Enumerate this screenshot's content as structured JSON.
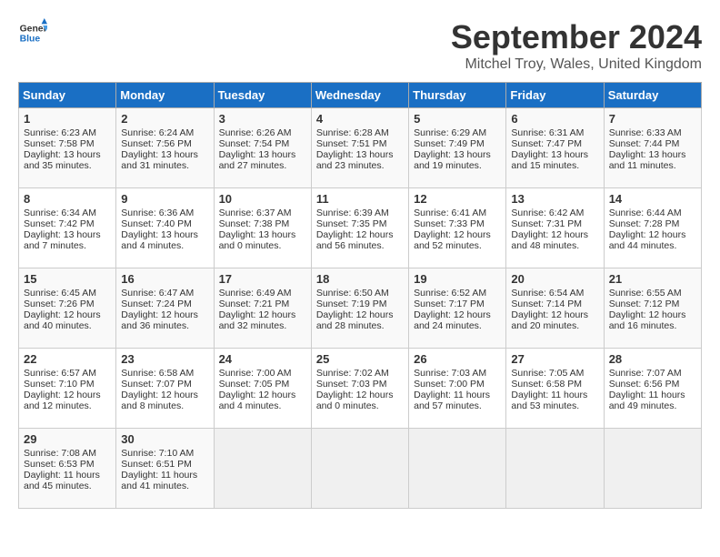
{
  "header": {
    "logo_line1": "General",
    "logo_line2": "Blue",
    "month": "September 2024",
    "location": "Mitchel Troy, Wales, United Kingdom"
  },
  "days_of_week": [
    "Sunday",
    "Monday",
    "Tuesday",
    "Wednesday",
    "Thursday",
    "Friday",
    "Saturday"
  ],
  "weeks": [
    [
      {
        "day": "1",
        "lines": [
          "Sunrise: 6:23 AM",
          "Sunset: 7:58 PM",
          "Daylight: 13 hours",
          "and 35 minutes."
        ]
      },
      {
        "day": "2",
        "lines": [
          "Sunrise: 6:24 AM",
          "Sunset: 7:56 PM",
          "Daylight: 13 hours",
          "and 31 minutes."
        ]
      },
      {
        "day": "3",
        "lines": [
          "Sunrise: 6:26 AM",
          "Sunset: 7:54 PM",
          "Daylight: 13 hours",
          "and 27 minutes."
        ]
      },
      {
        "day": "4",
        "lines": [
          "Sunrise: 6:28 AM",
          "Sunset: 7:51 PM",
          "Daylight: 13 hours",
          "and 23 minutes."
        ]
      },
      {
        "day": "5",
        "lines": [
          "Sunrise: 6:29 AM",
          "Sunset: 7:49 PM",
          "Daylight: 13 hours",
          "and 19 minutes."
        ]
      },
      {
        "day": "6",
        "lines": [
          "Sunrise: 6:31 AM",
          "Sunset: 7:47 PM",
          "Daylight: 13 hours",
          "and 15 minutes."
        ]
      },
      {
        "day": "7",
        "lines": [
          "Sunrise: 6:33 AM",
          "Sunset: 7:44 PM",
          "Daylight: 13 hours",
          "and 11 minutes."
        ]
      }
    ],
    [
      {
        "day": "8",
        "lines": [
          "Sunrise: 6:34 AM",
          "Sunset: 7:42 PM",
          "Daylight: 13 hours",
          "and 7 minutes."
        ]
      },
      {
        "day": "9",
        "lines": [
          "Sunrise: 6:36 AM",
          "Sunset: 7:40 PM",
          "Daylight: 13 hours",
          "and 4 minutes."
        ]
      },
      {
        "day": "10",
        "lines": [
          "Sunrise: 6:37 AM",
          "Sunset: 7:38 PM",
          "Daylight: 13 hours",
          "and 0 minutes."
        ]
      },
      {
        "day": "11",
        "lines": [
          "Sunrise: 6:39 AM",
          "Sunset: 7:35 PM",
          "Daylight: 12 hours",
          "and 56 minutes."
        ]
      },
      {
        "day": "12",
        "lines": [
          "Sunrise: 6:41 AM",
          "Sunset: 7:33 PM",
          "Daylight: 12 hours",
          "and 52 minutes."
        ]
      },
      {
        "day": "13",
        "lines": [
          "Sunrise: 6:42 AM",
          "Sunset: 7:31 PM",
          "Daylight: 12 hours",
          "and 48 minutes."
        ]
      },
      {
        "day": "14",
        "lines": [
          "Sunrise: 6:44 AM",
          "Sunset: 7:28 PM",
          "Daylight: 12 hours",
          "and 44 minutes."
        ]
      }
    ],
    [
      {
        "day": "15",
        "lines": [
          "Sunrise: 6:45 AM",
          "Sunset: 7:26 PM",
          "Daylight: 12 hours",
          "and 40 minutes."
        ]
      },
      {
        "day": "16",
        "lines": [
          "Sunrise: 6:47 AM",
          "Sunset: 7:24 PM",
          "Daylight: 12 hours",
          "and 36 minutes."
        ]
      },
      {
        "day": "17",
        "lines": [
          "Sunrise: 6:49 AM",
          "Sunset: 7:21 PM",
          "Daylight: 12 hours",
          "and 32 minutes."
        ]
      },
      {
        "day": "18",
        "lines": [
          "Sunrise: 6:50 AM",
          "Sunset: 7:19 PM",
          "Daylight: 12 hours",
          "and 28 minutes."
        ]
      },
      {
        "day": "19",
        "lines": [
          "Sunrise: 6:52 AM",
          "Sunset: 7:17 PM",
          "Daylight: 12 hours",
          "and 24 minutes."
        ]
      },
      {
        "day": "20",
        "lines": [
          "Sunrise: 6:54 AM",
          "Sunset: 7:14 PM",
          "Daylight: 12 hours",
          "and 20 minutes."
        ]
      },
      {
        "day": "21",
        "lines": [
          "Sunrise: 6:55 AM",
          "Sunset: 7:12 PM",
          "Daylight: 12 hours",
          "and 16 minutes."
        ]
      }
    ],
    [
      {
        "day": "22",
        "lines": [
          "Sunrise: 6:57 AM",
          "Sunset: 7:10 PM",
          "Daylight: 12 hours",
          "and 12 minutes."
        ]
      },
      {
        "day": "23",
        "lines": [
          "Sunrise: 6:58 AM",
          "Sunset: 7:07 PM",
          "Daylight: 12 hours",
          "and 8 minutes."
        ]
      },
      {
        "day": "24",
        "lines": [
          "Sunrise: 7:00 AM",
          "Sunset: 7:05 PM",
          "Daylight: 12 hours",
          "and 4 minutes."
        ]
      },
      {
        "day": "25",
        "lines": [
          "Sunrise: 7:02 AM",
          "Sunset: 7:03 PM",
          "Daylight: 12 hours",
          "and 0 minutes."
        ]
      },
      {
        "day": "26",
        "lines": [
          "Sunrise: 7:03 AM",
          "Sunset: 7:00 PM",
          "Daylight: 11 hours",
          "and 57 minutes."
        ]
      },
      {
        "day": "27",
        "lines": [
          "Sunrise: 7:05 AM",
          "Sunset: 6:58 PM",
          "Daylight: 11 hours",
          "and 53 minutes."
        ]
      },
      {
        "day": "28",
        "lines": [
          "Sunrise: 7:07 AM",
          "Sunset: 6:56 PM",
          "Daylight: 11 hours",
          "and 49 minutes."
        ]
      }
    ],
    [
      {
        "day": "29",
        "lines": [
          "Sunrise: 7:08 AM",
          "Sunset: 6:53 PM",
          "Daylight: 11 hours",
          "and 45 minutes."
        ]
      },
      {
        "day": "30",
        "lines": [
          "Sunrise: 7:10 AM",
          "Sunset: 6:51 PM",
          "Daylight: 11 hours",
          "and 41 minutes."
        ]
      },
      {
        "day": "",
        "lines": []
      },
      {
        "day": "",
        "lines": []
      },
      {
        "day": "",
        "lines": []
      },
      {
        "day": "",
        "lines": []
      },
      {
        "day": "",
        "lines": []
      }
    ]
  ]
}
